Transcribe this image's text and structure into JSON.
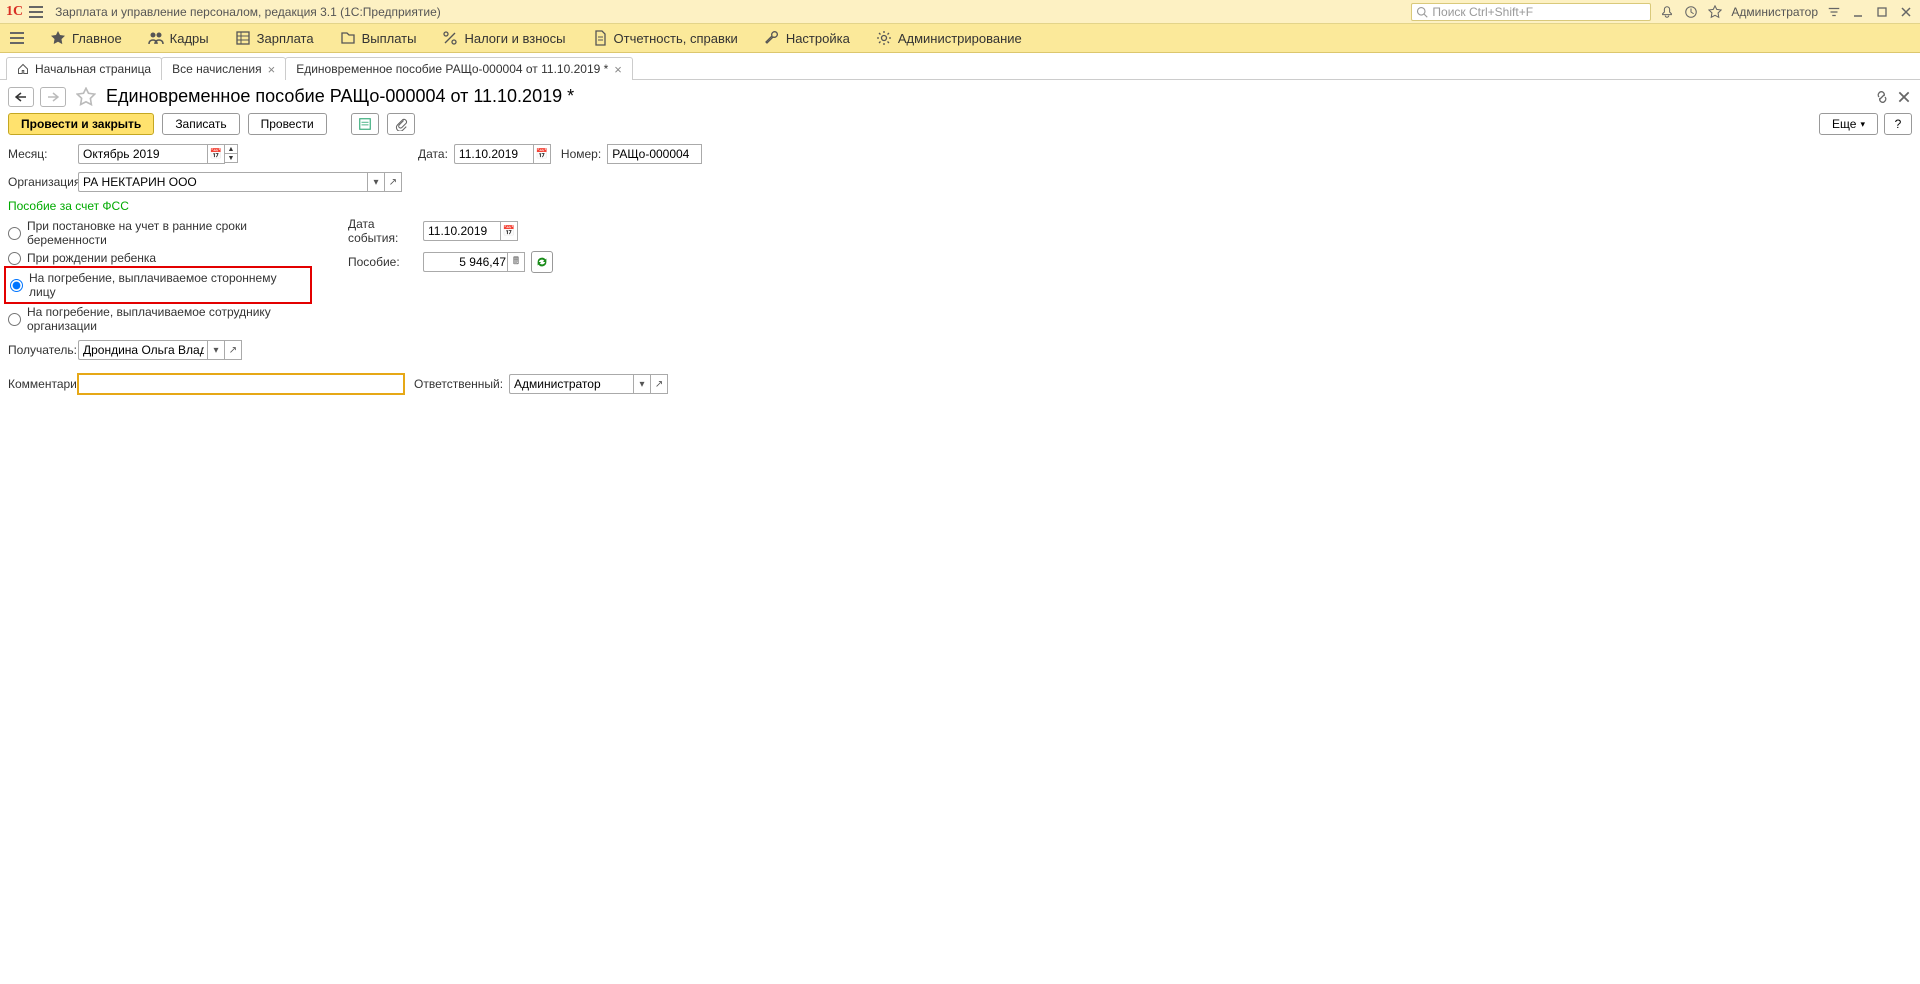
{
  "titlebar": {
    "logo_text": "1C",
    "app_title": "Зарплата и управление персоналом, редакция 3.1  (1С:Предприятие)",
    "search_placeholder": "Поиск Ctrl+Shift+F",
    "user_label": "Администратор"
  },
  "menubar": {
    "items": [
      {
        "label": "Главное",
        "icon": "star"
      },
      {
        "label": "Кадры",
        "icon": "people"
      },
      {
        "label": "Зарплата",
        "icon": "table"
      },
      {
        "label": "Выплаты",
        "icon": "folder"
      },
      {
        "label": "Налоги и взносы",
        "icon": "percent"
      },
      {
        "label": "Отчетность, справки",
        "icon": "doc"
      },
      {
        "label": "Настройка",
        "icon": "wrench"
      },
      {
        "label": "Администрирование",
        "icon": "gear"
      }
    ]
  },
  "tabs": [
    {
      "label": "Начальная страница",
      "closable": false,
      "home": true
    },
    {
      "label": "Все начисления",
      "closable": true
    },
    {
      "label": "Единовременное пособие РАЩо-000004 от 11.10.2019 *",
      "closable": true,
      "active": true
    }
  ],
  "page": {
    "title": "Единовременное пособие РАЩо-000004 от 11.10.2019 *"
  },
  "cmdbar": {
    "post_and_close": "Провести и закрыть",
    "save": "Записать",
    "post": "Провести",
    "more": "Еще",
    "help": "?"
  },
  "form": {
    "month_label": "Месяц:",
    "month_value": "Октябрь 2019",
    "date_label": "Дата:",
    "date_value": "11.10.2019",
    "number_label": "Номер:",
    "number_value": "РАЩо-000004",
    "org_label": "Организация:",
    "org_value": "РА НЕКТАРИН ООО",
    "fss_title": "Пособие за счет ФСС",
    "radio1": "При постановке на учет в ранние сроки беременности",
    "radio2": "При рождении ребенка",
    "radio3": "На погребение, выплачиваемое стороннему лицу",
    "radio4": "На погребение, выплачиваемое сотруднику организации",
    "event_date_label": "Дата события:",
    "event_date_value": "11.10.2019",
    "benefit_label": "Пособие:",
    "benefit_value": "5 946,47",
    "recipient_label": "Получатель:",
    "recipient_value": "Дрондина Ольга Владими",
    "comment_label": "Комментарий:",
    "responsible_label": "Ответственный:",
    "responsible_value": "Администратор"
  }
}
